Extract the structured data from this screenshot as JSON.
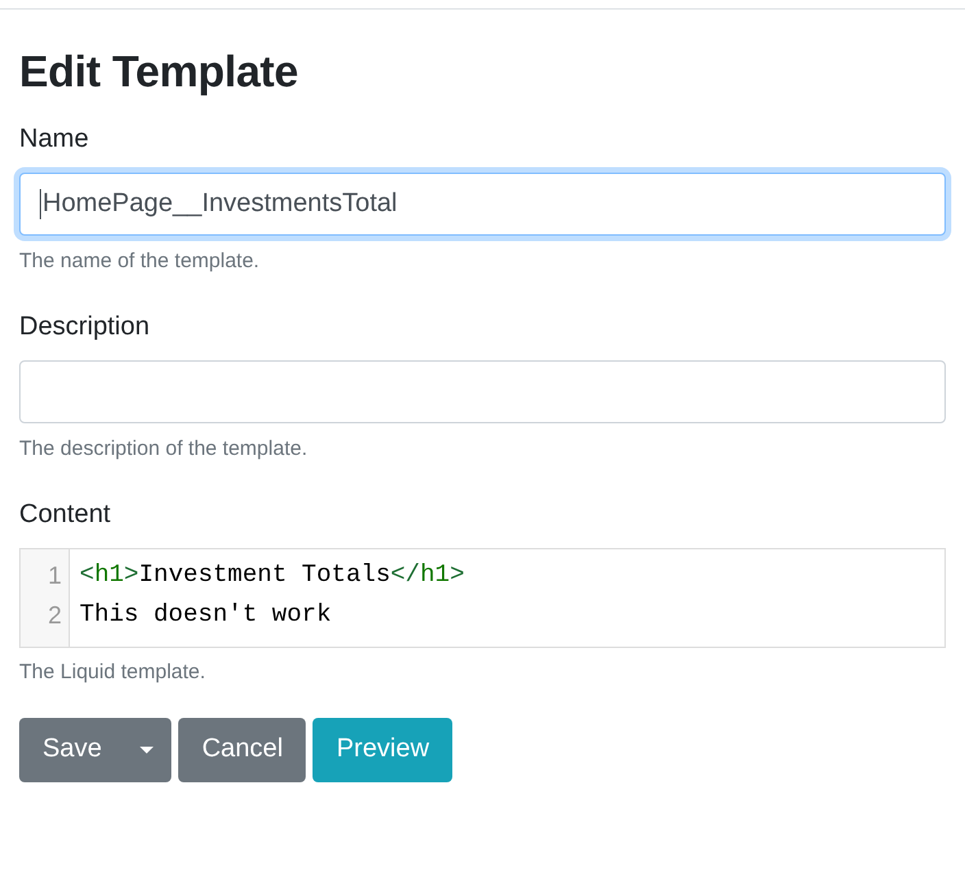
{
  "page": {
    "title": "Edit Template"
  },
  "fields": [
    {
      "kind": "text",
      "label": "Name",
      "value": "HomePage__InvestmentsTotal",
      "focused": true,
      "help": "The name of the template."
    },
    {
      "kind": "text",
      "label": "Description",
      "focused": false,
      "help": "The description of the template."
    },
    {
      "kind": "code",
      "label": "Content",
      "focused": false,
      "lines": [
        {
          "number": "1",
          "tokens": [
            {
              "text": "<",
              "kind": "bracket"
            },
            {
              "text": "h1",
              "kind": "tag"
            },
            {
              "text": ">",
              "kind": "bracket"
            },
            {
              "text": "Investment Totals",
              "kind": "plain"
            },
            {
              "text": "</",
              "kind": "bracket"
            },
            {
              "text": "h1",
              "kind": "tag"
            },
            {
              "text": ">",
              "kind": "bracket"
            }
          ]
        },
        {
          "number": "2",
          "tokens": [
            {
              "text": "This doesn't work",
              "kind": "plain"
            }
          ]
        }
      ],
      "help": "The Liquid template."
    }
  ],
  "buttons": [
    {
      "label": "Save",
      "color": "#6c757d",
      "dropdown": true
    },
    {
      "label": "Cancel",
      "color": "#6c757d",
      "dropdown": false
    },
    {
      "label": "Preview",
      "color": "#17a2b8",
      "dropdown": false
    }
  ]
}
